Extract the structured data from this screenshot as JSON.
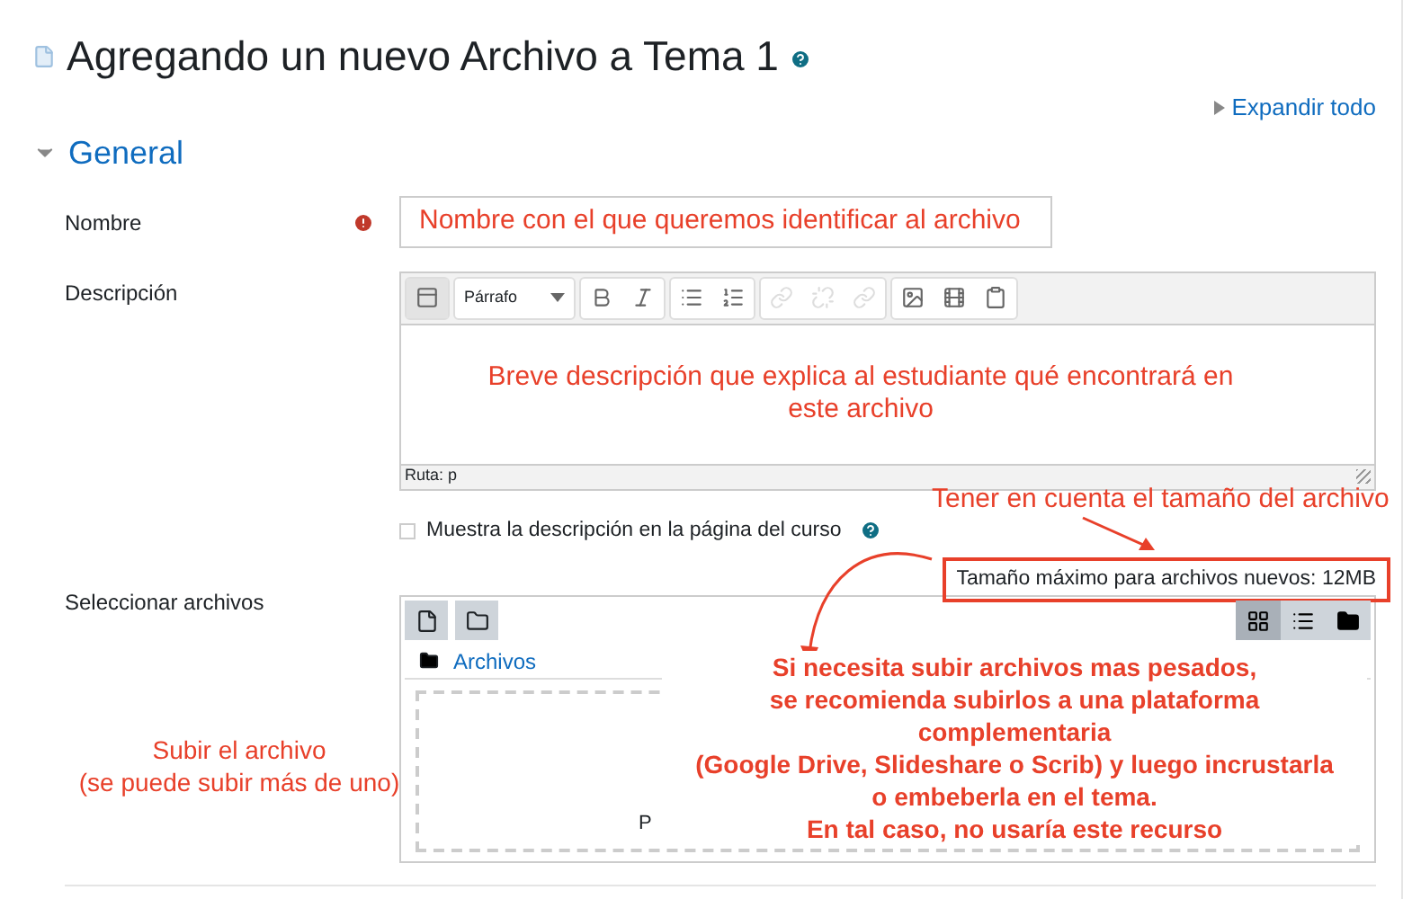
{
  "page": {
    "title": "Agregando un nuevo Archivo a Tema 1",
    "expand_all": "Expandir todo"
  },
  "section": {
    "title": "General",
    "expanded": true
  },
  "name_field": {
    "label": "Nombre",
    "required": true,
    "value": "Nombre con el que queremos identificar al archivo"
  },
  "description": {
    "label": "Descripción",
    "format": "Párrafo",
    "path": "Ruta: p",
    "body": [
      "Breve descripción que explica al estudiante qué encontrará en",
      "este archivo"
    ],
    "toolbar": [
      {
        "kind": "toggle",
        "disabled": false
      },
      {
        "kind": "bold",
        "disabled": false
      },
      {
        "kind": "italic",
        "disabled": false
      },
      {
        "kind": "bullets",
        "disabled": false
      },
      {
        "kind": "numbers",
        "disabled": false
      },
      {
        "kind": "link",
        "disabled": true
      },
      {
        "kind": "unlink",
        "disabled": true
      },
      {
        "kind": "anchor",
        "disabled": true
      },
      {
        "kind": "image",
        "disabled": false
      },
      {
        "kind": "media",
        "disabled": false
      },
      {
        "kind": "paste",
        "disabled": false
      }
    ]
  },
  "show_description": {
    "label": "Muestra la descripción en la página del curso",
    "checked": false
  },
  "files": {
    "label": "Seleccionar archivos",
    "max_size": "Tamaño máximo para archivos nuevos: 12MB",
    "folder": "Archivos",
    "dropzone_text": "P",
    "views": [
      {
        "kind": "icons",
        "selected": true
      },
      {
        "kind": "list",
        "selected": false
      },
      {
        "kind": "tree",
        "selected": false
      }
    ]
  },
  "annotations": {
    "size_note": "Tener en cuenta el tamaño del archivo",
    "upload_note": [
      "Subir el archivo",
      "(se puede subir más de uno)"
    ],
    "platform_note": [
      "Si necesita subir archivos mas pesados,",
      "se recomienda subirlos a una plataforma",
      "complementaria",
      "(Google Drive, Slideshare o Scrib) y luego incrustarla",
      "o embeberla en el tema.",
      "En tal caso, no usaría este recurso"
    ]
  }
}
